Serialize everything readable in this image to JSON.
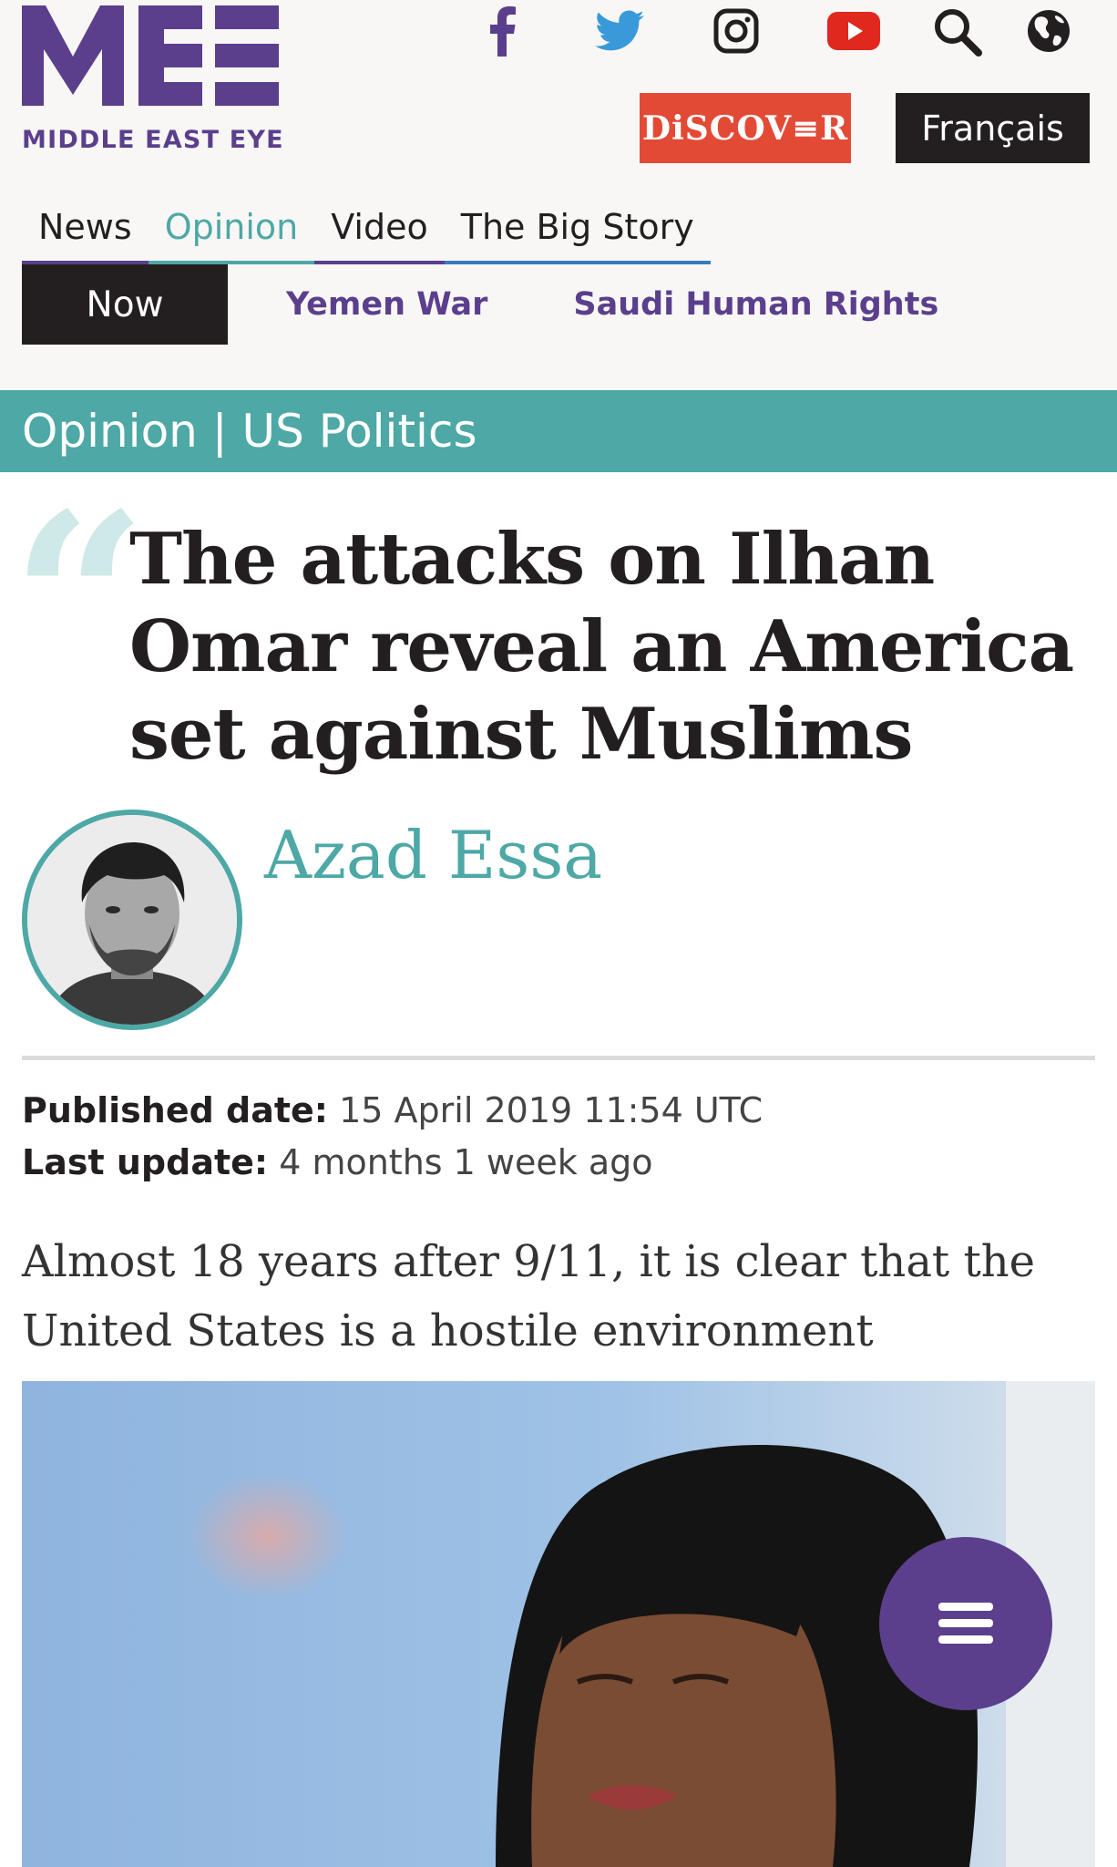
{
  "site": {
    "logo_text": "MIDDLE EAST EYE",
    "brand_color": "#5b3f8c",
    "accent_color": "#4da8a6"
  },
  "header": {
    "social_icons": [
      "facebook-icon",
      "twitter-icon",
      "instagram-icon",
      "youtube-icon",
      "search-icon",
      "globe-icon"
    ],
    "discover_label": "DiSCOV≡R",
    "francais_label": "Français"
  },
  "nav": {
    "main": [
      "News",
      "Opinion",
      "Video",
      "The Big Story"
    ],
    "active": "Opinion",
    "now_label": "Now",
    "sub": [
      "Yemen War",
      "Saudi Human Rights"
    ]
  },
  "category": "Opinion | US Politics",
  "article": {
    "title": "The attacks on Ilhan Omar reveal an America set against Muslims",
    "author": "Azad Essa",
    "published_label": "Published date:",
    "published_value": "15 April 2019 11:54 UTC",
    "updated_label": "Last update:",
    "updated_value": "4 months 1 week ago",
    "lede": "Almost 18 years after 9/11, it is clear that the United States is a hostile environment"
  },
  "fab": {
    "icon": "hamburger-menu-icon"
  }
}
